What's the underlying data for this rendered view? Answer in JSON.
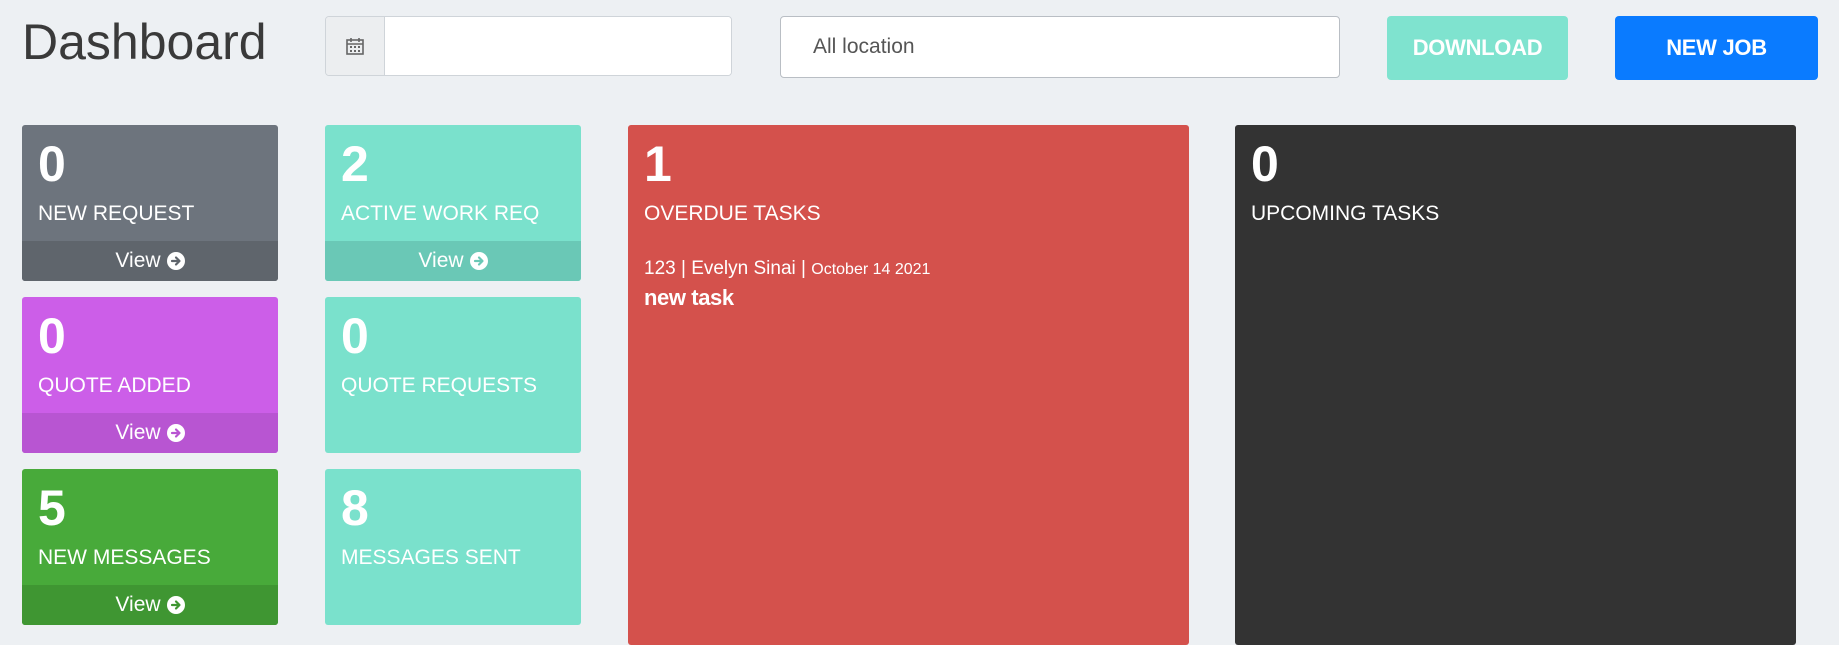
{
  "header": {
    "title": "Dashboard",
    "date_input": {
      "value": "",
      "placeholder": ""
    },
    "location_select": {
      "selected": "All location"
    },
    "download_label": "DOWNLOAD",
    "new_job_label": "NEW JOB"
  },
  "cards": {
    "new_request": {
      "count": "0",
      "label": "NEW REQUEST",
      "footer": "View"
    },
    "active_work_req": {
      "count": "2",
      "label": "ACTIVE WORK REQ",
      "footer": "View"
    },
    "quote_added": {
      "count": "0",
      "label": "QUOTE ADDED",
      "footer": "View"
    },
    "quote_requests": {
      "count": "0",
      "label": "QUOTE REQUESTS"
    },
    "new_messages": {
      "count": "5",
      "label": "NEW MESSAGES",
      "footer": "View"
    },
    "messages_sent": {
      "count": "8",
      "label": "MESSAGES SENT"
    },
    "overdue_tasks": {
      "count": "1",
      "label": "OVERDUE TASKS",
      "tasks": [
        {
          "meta": "123 | Evelyn Sinai |",
          "date": "October 14 2021",
          "name": "new task"
        }
      ]
    },
    "upcoming_tasks": {
      "count": "0",
      "label": "UPCOMING TASKS"
    }
  },
  "colors": {
    "new_request": "#6d747d",
    "active_work_req": "#7ae1cc",
    "quote_added": "#cc5ee8",
    "new_messages": "#48aa3a",
    "overdue_tasks": "#d4514c",
    "upcoming_tasks": "#333333",
    "download_button": "#7fe3cf",
    "new_job_button": "#0a7bff"
  },
  "icons": {
    "date_addon": "calendar-icon",
    "view_arrow": "arrow-circle-right-icon"
  }
}
